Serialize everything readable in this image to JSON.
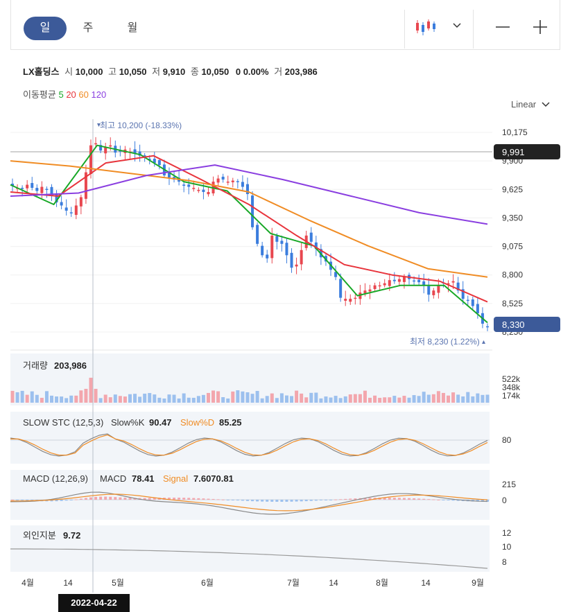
{
  "toolbar": {
    "periods": [
      {
        "label": "일",
        "active": true
      },
      {
        "label": "주",
        "active": false
      },
      {
        "label": "월",
        "active": false
      }
    ]
  },
  "stock": {
    "name": "LX홀딩스",
    "open_label": "시",
    "open": "10,000",
    "high_label": "고",
    "high": "10,050",
    "low_label": "저",
    "low": "9,910",
    "close_label": "종",
    "close": "10,050",
    "change": "0",
    "change_pct": "0.00%",
    "volume_label": "거",
    "volume": "203,986"
  },
  "ma_legend": {
    "label": "이동평균",
    "p5": "5",
    "p20": "20",
    "p60": "60",
    "p120": "120"
  },
  "scale_mode": "Linear",
  "colors": {
    "up": "#e8474f",
    "down": "#3b7ddd",
    "ma5": "#18a827",
    "ma20": "#e8343c",
    "ma60": "#f08c24",
    "ma120": "#8a3ee0",
    "accent": "#3c5a99",
    "vol_up": "#f3a6ad",
    "vol_down": "#9cc0ee"
  },
  "chart_data": [
    {
      "type": "candlestick",
      "title": "LX홀딩스",
      "x_ticks": [
        "4월",
        "14",
        "5월",
        "6월",
        "7월",
        "14",
        "8월",
        "14",
        "9월"
      ],
      "y_ticks": [
        10175,
        9900,
        9625,
        9350,
        9075,
        8800,
        8525,
        8250
      ],
      "ylim": [
        8150,
        10400
      ],
      "crosshair_price": "9,991",
      "last_price": "8,330",
      "high_annotation": "최고 10,200 (-18.33%)",
      "low_annotation": "최저 8,230 (1.22%)",
      "crosshair_date": "2022-04-22",
      "closes": [
        9660,
        9640,
        9630,
        9670,
        9640,
        9610,
        9650,
        9620,
        9560,
        9500,
        9470,
        9420,
        9400,
        9470,
        9550,
        9790,
        10050,
        10070,
        10000,
        10030,
        10050,
        9980,
        9990,
        10010,
        9990,
        9970,
        9950,
        9930,
        9910,
        9880,
        9860,
        9760,
        9740,
        9720,
        9700,
        9660,
        9650,
        9640,
        9620,
        9600,
        9600,
        9700,
        9730,
        9720,
        9700,
        9710,
        9700,
        9650,
        9580,
        9260,
        9100,
        8990,
        8960,
        9180,
        9120,
        9100,
        8990,
        8870,
        8900,
        9040,
        9180,
        9120,
        9050,
        8970,
        8930,
        8850,
        8780,
        8580,
        8570,
        8570,
        8580,
        8630,
        8650,
        8660,
        8700,
        8700,
        8720,
        8750,
        8740,
        8760,
        8780,
        8760,
        8740,
        8730,
        8700,
        8610,
        8650,
        8700,
        8720,
        8720,
        8740,
        8650,
        8570,
        8560,
        8500,
        8430,
        8330,
        8300
      ],
      "ma_series": [
        {
          "name": "5",
          "start": 9670,
          "mid": [
            9480,
            10050,
            9960,
            9700,
            9610,
            9200,
            9080,
            8600,
            8700,
            8700
          ],
          "end": 8340
        },
        {
          "name": "20",
          "start": 9600,
          "mid": [
            9560,
            9880,
            9950,
            9720,
            9480,
            9180,
            8900,
            8800,
            8740
          ],
          "end": 8540
        },
        {
          "name": "60",
          "start": 9900,
          "mid": [
            9850,
            9780,
            9710,
            9600,
            9330,
            9080,
            8860
          ],
          "end": 8780
        },
        {
          "name": "120",
          "start": 9560,
          "mid": [
            9590,
            9760,
            9860,
            9720,
            9560,
            9400
          ],
          "end": 9290
        }
      ]
    },
    {
      "type": "bar",
      "title": "거래량",
      "value": "203,986",
      "y_ticks": [
        "522k",
        "348k",
        "174k"
      ]
    },
    {
      "type": "line",
      "title": "SLOW STC (12,5,3)",
      "series": [
        {
          "name": "Slow%K",
          "value": "90.47"
        },
        {
          "name": "Slow%D",
          "value": "85.25"
        }
      ],
      "y_ticks": [
        "80"
      ]
    },
    {
      "type": "line",
      "title": "MACD (12,26,9)",
      "series": [
        {
          "name": "MACD",
          "value": "78.41"
        },
        {
          "name": "Signal",
          "value": "7.6070.81"
        }
      ],
      "y_ticks": [
        "215",
        "0"
      ]
    },
    {
      "type": "line",
      "title": "외인지분",
      "value": "9.72",
      "y_ticks": [
        "12",
        "10",
        "8"
      ]
    }
  ]
}
